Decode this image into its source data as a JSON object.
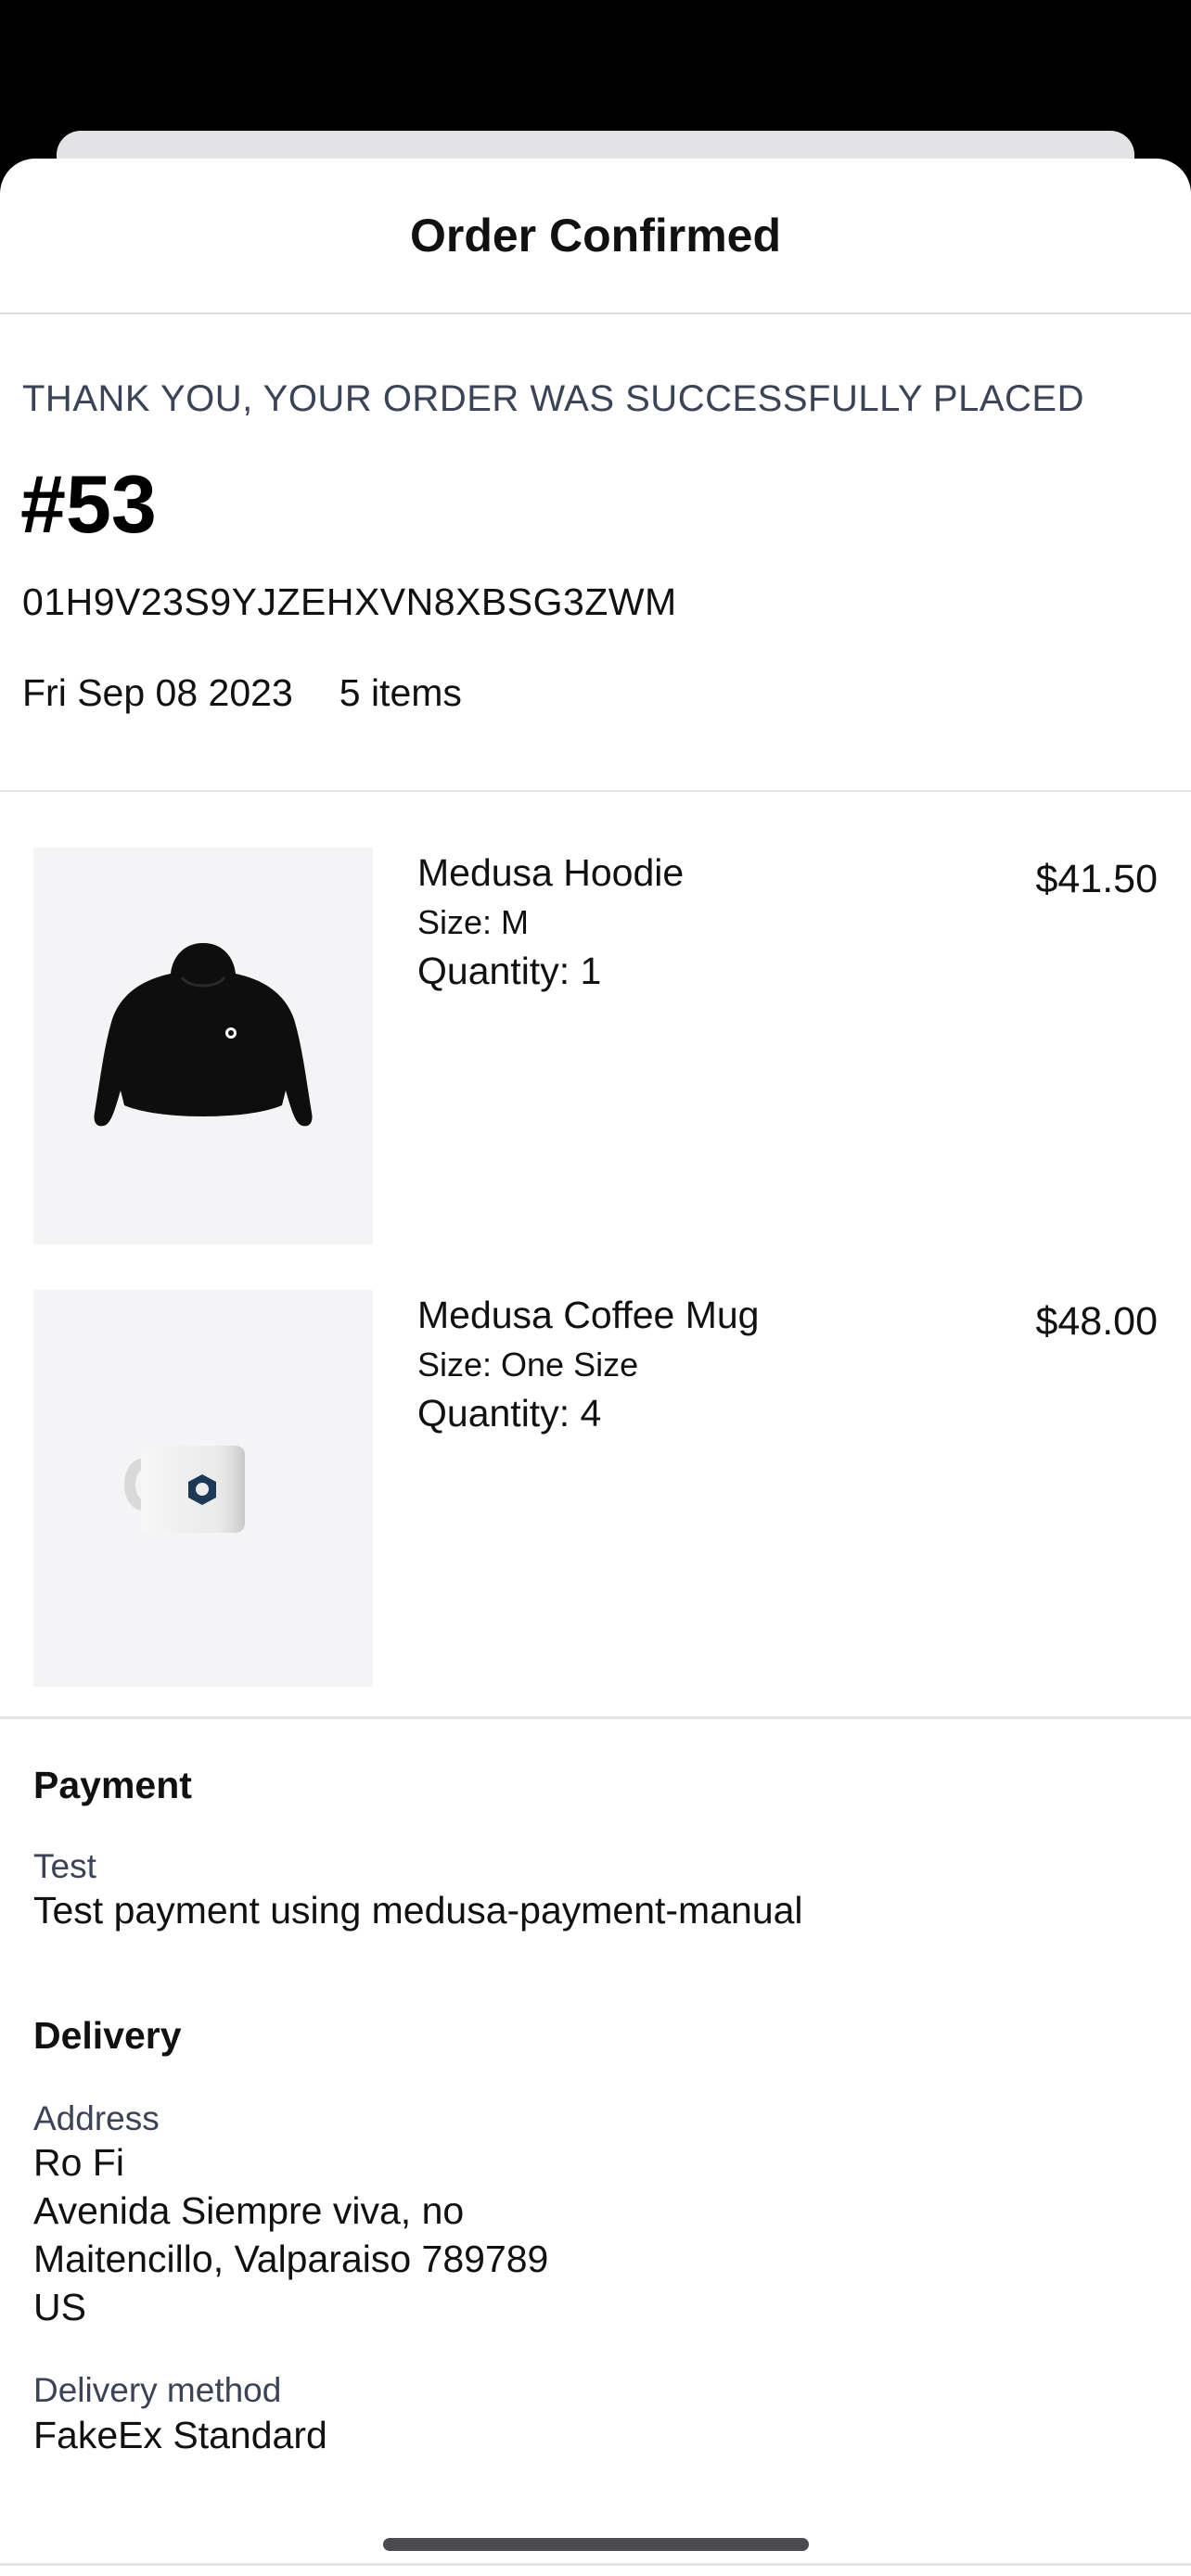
{
  "header": {
    "title": "Order Confirmed"
  },
  "summary": {
    "thanks": "THANK YOU, YOUR ORDER WAS SUCCESSFULLY PLACED",
    "order_number": "#53",
    "order_id": "01H9V23S9YJZEHXVN8XBSG3ZWM",
    "date": "Fri Sep 08 2023",
    "item_count": "5 items"
  },
  "items": [
    {
      "name": "Medusa Hoodie",
      "size": "Size: M",
      "quantity": "Quantity: 1",
      "price": "$41.50",
      "image": "black-hoodie"
    },
    {
      "name": "Medusa Coffee Mug",
      "size": "Size: One Size",
      "quantity": "Quantity: 4",
      "price": "$48.00",
      "image": "white-mug"
    }
  ],
  "payment": {
    "title": "Payment",
    "provider": "Test",
    "description": "Test payment using medusa-payment-manual"
  },
  "delivery": {
    "title": "Delivery",
    "address_label": "Address",
    "address_lines": [
      "Ro Fi",
      "Avenida Siempre viva, no",
      "Maitencillo, Valparaiso 789789",
      "US"
    ],
    "method_label": "Delivery method",
    "method": "FakeEx Standard"
  },
  "colors": {
    "accent_text": "#3b4356",
    "thumb_bg": "#f4f4f6",
    "divider": "#e4e4e7"
  }
}
